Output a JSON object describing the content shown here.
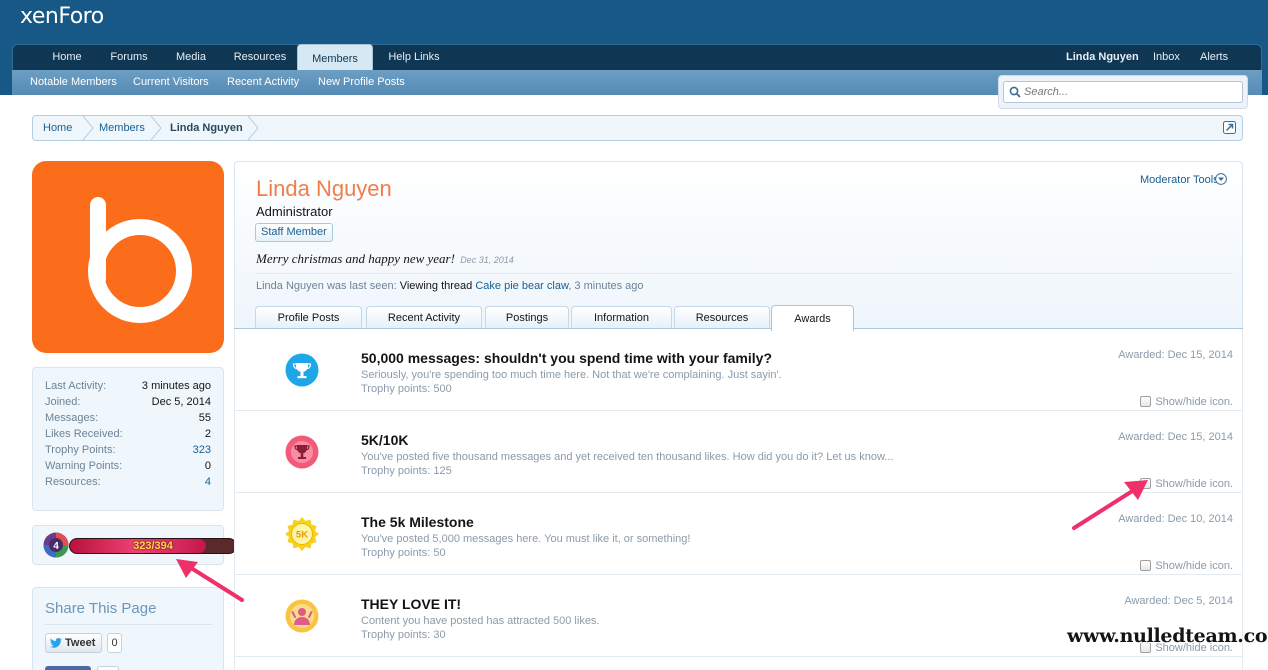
{
  "logo": {
    "text": "xenForo"
  },
  "nav": {
    "tabs": [
      {
        "label": "Home"
      },
      {
        "label": "Forums"
      },
      {
        "label": "Media"
      },
      {
        "label": "Resources"
      },
      {
        "label": "Members"
      },
      {
        "label": "Help Links"
      }
    ],
    "active": "Members",
    "user_label": "Linda Nguyen",
    "inbox_label": "Inbox",
    "alerts_label": "Alerts"
  },
  "subnav": {
    "items": [
      {
        "label": "Notable Members"
      },
      {
        "label": "Current Visitors"
      },
      {
        "label": "Recent Activity"
      },
      {
        "label": "New Profile Posts"
      }
    ]
  },
  "search": {
    "placeholder": "Search..."
  },
  "breadcrumb": {
    "items": [
      "Home",
      "Members",
      "Linda Nguyen"
    ]
  },
  "profile": {
    "name": "Linda Nguyen",
    "title": "Administrator",
    "badge": "Staff Member",
    "status": "Merry christmas and happy new year!",
    "status_date": "Dec 31, 2014",
    "last_seen_prefix": "Linda Nguyen was last seen:",
    "last_seen_action": "Viewing thread",
    "last_seen_thread": "Cake pie bear claw",
    "last_seen_time": ", 3 minutes ago",
    "moderator_tools": "Moderator Tools"
  },
  "stats": [
    {
      "label": "Last Activity:",
      "value": "3 minutes ago"
    },
    {
      "label": "Joined:",
      "value": "Dec 5, 2014"
    },
    {
      "label": "Messages:",
      "value": "55"
    },
    {
      "label": "Likes Received:",
      "value": "2"
    },
    {
      "label": "Trophy Points:",
      "value": "323"
    },
    {
      "label": "Warning Points:",
      "value": "0"
    },
    {
      "label": "Resources:",
      "value": "4"
    }
  ],
  "level": {
    "badge": "4",
    "text": "323/394",
    "current": 323,
    "max": 394
  },
  "share": {
    "title": "Share This Page",
    "tweet_label": "Tweet",
    "tweet_count": "0"
  },
  "tabs": [
    {
      "label": "Profile Posts"
    },
    {
      "label": "Recent Activity"
    },
    {
      "label": "Postings"
    },
    {
      "label": "Information"
    },
    {
      "label": "Resources"
    },
    {
      "label": "Awards"
    }
  ],
  "active_tab": "Awards",
  "awards": [
    {
      "title": "50,000 messages: shouldn't you spend time with your family?",
      "desc": "Seriously, you're spending too much time here. Not that we're complaining. Just sayin'.",
      "points": "Trophy points: 500",
      "date": "Awarded: Dec 15, 2014",
      "toggle": "Show/hide icon.",
      "icon": "trophy-icon",
      "color": "#1ea7e8"
    },
    {
      "title": "5K/10K",
      "desc": "You've posted five thousand messages and yet received ten thousand likes. How did you do it? Let us know...",
      "points": "Trophy points: 125",
      "date": "Awarded: Dec 15, 2014",
      "toggle": "Show/hide icon.",
      "icon": "trophy-icon",
      "color": "#f25a7a"
    },
    {
      "title": "The 5k Milestone",
      "desc": "You've posted 5,000 messages here. You must like it, or something!",
      "points": "Trophy points: 50",
      "date": "Awarded: Dec 10, 2014",
      "toggle": "Show/hide icon.",
      "icon": "5k-medal-icon",
      "icon_text": "5K",
      "color": "#f7d21c"
    },
    {
      "title": "THEY LOVE IT!",
      "desc": "Content you have posted has attracted 500 likes.",
      "points": "Trophy points: 30",
      "date": "Awarded: Dec 5, 2014",
      "toggle": "Show/hide icon.",
      "icon": "fan-icon",
      "color": "#f7c542"
    }
  ],
  "watermark": "www.nulledteam.com",
  "colors": {
    "header": "#185886",
    "accent": "#176093",
    "username": "#f07e4a",
    "avatar": "#fb6d1a"
  }
}
